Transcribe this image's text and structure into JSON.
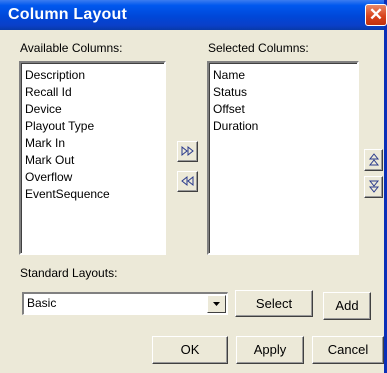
{
  "dialog": {
    "title": "Column Layout",
    "close_glyph": "✕"
  },
  "available": {
    "label": "Available Columns:",
    "items": [
      "Description",
      "Recall Id",
      "Device",
      "Playout Type",
      "Mark In",
      "Mark Out",
      "Overflow",
      "EventSequence"
    ]
  },
  "selected": {
    "label": "Selected Columns:",
    "items": [
      "Name",
      "Status",
      "Offset",
      "Duration"
    ]
  },
  "transfer": {
    "add_icon": "double-right-arrow-icon",
    "remove_icon": "double-left-arrow-icon"
  },
  "ordering": {
    "up_icon": "move-up-icon",
    "down_icon": "move-down-icon"
  },
  "layouts": {
    "label": "Standard Layouts:",
    "value": "Basic",
    "select_label": "Select",
    "add_label": "Add"
  },
  "footer": {
    "ok_label": "OK",
    "apply_label": "Apply",
    "cancel_label": "Cancel"
  },
  "colors": {
    "titlebar": "#0047d8",
    "face": "#ece9d8",
    "close": "#d9441d"
  }
}
